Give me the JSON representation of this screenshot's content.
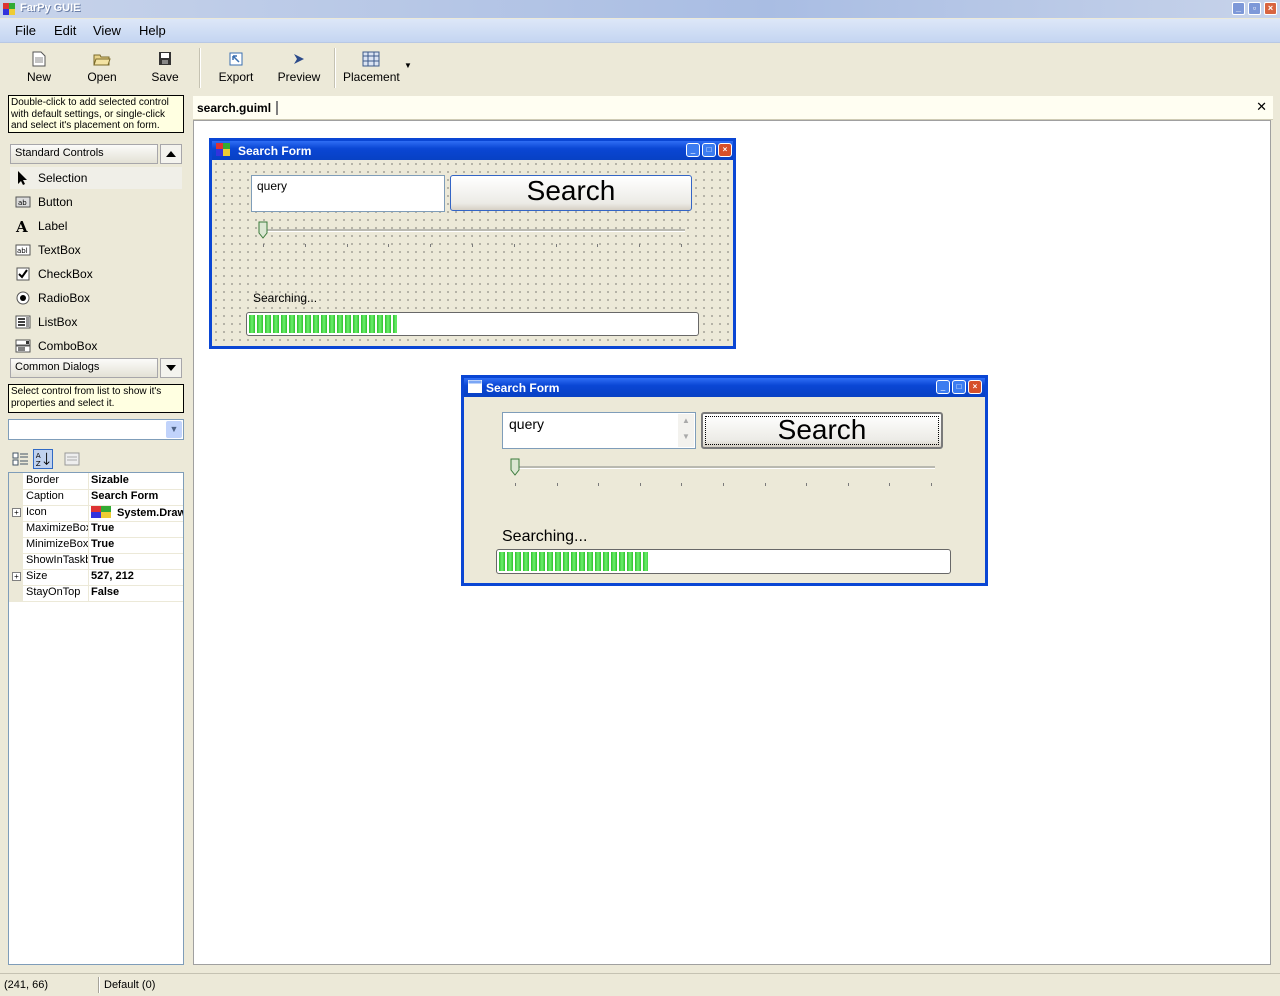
{
  "app": {
    "title": "FarPy GUIE",
    "window_buttons": [
      "minimize-icon",
      "restore-icon",
      "close-icon"
    ]
  },
  "menu": [
    "File",
    "Edit",
    "View",
    "Help"
  ],
  "toolbar": {
    "new": "New",
    "open": "Open",
    "save": "Save",
    "export": "Export",
    "preview": "Preview",
    "placement": "Placement"
  },
  "left_panel": {
    "hint_top": "Double-click to add selected control with default settings, or single-click and select it's placement on form.",
    "standard_controls": "Standard Controls",
    "tools": [
      {
        "label": "Selection",
        "icon": "arrow-cursor-icon"
      },
      {
        "label": "Button",
        "icon": "button-icon"
      },
      {
        "label": "Label",
        "icon": "label-icon"
      },
      {
        "label": "TextBox",
        "icon": "textbox-icon"
      },
      {
        "label": "CheckBox",
        "icon": "checkbox-icon"
      },
      {
        "label": "RadioBox",
        "icon": "radiobox-icon"
      },
      {
        "label": "ListBox",
        "icon": "listbox-icon"
      },
      {
        "label": "ComboBox",
        "icon": "combobox-icon"
      }
    ],
    "common_dialogs": "Common Dialogs",
    "hint_bottom": "Select control from list to show it's properties and select it.",
    "control_select_value": ""
  },
  "properties": [
    {
      "name": "Border",
      "value": "Sizable",
      "expandable": false
    },
    {
      "name": "Caption",
      "value": "Search Form",
      "expandable": false
    },
    {
      "name": "Icon",
      "value": "System.Drawing.Icon",
      "expandable": true
    },
    {
      "name": "MaximizeBox",
      "value": "True",
      "expandable": false
    },
    {
      "name": "MinimizeBox",
      "value": "True",
      "expandable": false
    },
    {
      "name": "ShowInTaskbar",
      "value": "True",
      "expandable": false
    },
    {
      "name": "Size",
      "value": "527, 212",
      "expandable": true
    },
    {
      "name": "StayOnTop",
      "value": "False",
      "expandable": false
    }
  ],
  "document": {
    "tab": "search.guiml"
  },
  "design_form": {
    "title": "Search Form",
    "query": "query",
    "button": "Search",
    "status": "Searching...",
    "progress": 0.33,
    "slider": 0
  },
  "preview_form": {
    "title": "Search Form",
    "query": "query",
    "button": "Search",
    "status": "Searching...",
    "progress": 0.33,
    "slider": 0
  },
  "status_bar": {
    "coords": "(241, 66)",
    "mode": "Default (0)"
  },
  "colors": {
    "xp_blue": "#0a46d4",
    "progress_green": "#2ec12e",
    "tooltip_yellow": "#ffffe1"
  }
}
